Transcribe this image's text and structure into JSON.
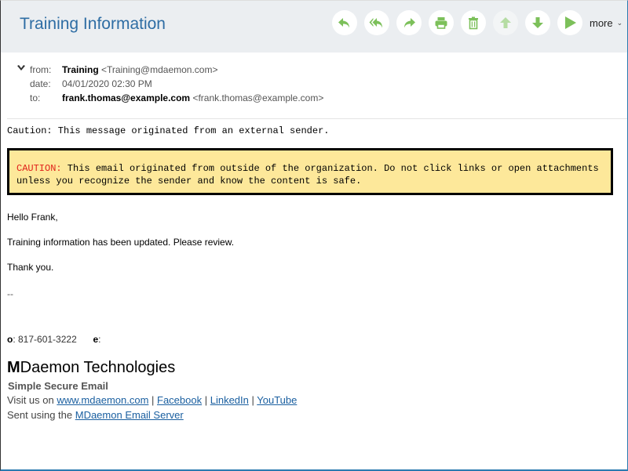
{
  "header": {
    "title": "Training Information",
    "toolbar": [
      {
        "name": "reply-button",
        "icon": "reply-icon",
        "disabled": false
      },
      {
        "name": "reply-all-button",
        "icon": "reply-all-icon",
        "disabled": false
      },
      {
        "name": "forward-button",
        "icon": "forward-icon",
        "disabled": false
      },
      {
        "name": "print-button",
        "icon": "print-icon",
        "disabled": false
      },
      {
        "name": "delete-button",
        "icon": "trash-icon",
        "disabled": false
      },
      {
        "name": "previous-button",
        "icon": "arrow-up-icon",
        "disabled": true
      },
      {
        "name": "next-button",
        "icon": "arrow-down-icon",
        "disabled": false
      },
      {
        "name": "play-button",
        "icon": "play-icon",
        "disabled": false
      }
    ],
    "more_label": "more",
    "more_chevron": "⌄",
    "accent_color": "#7cc05a"
  },
  "meta": {
    "toggle_glyph": "❯",
    "from_label": "from:",
    "from_name": "Training",
    "from_address": "<Training@mdaemon.com>",
    "date_label": "date:",
    "date_value": "04/01/2020 02:30 PM",
    "to_label": "to:",
    "to_name": "frank.thomas@example.com",
    "to_address": "<frank.thomas@example.com>"
  },
  "body": {
    "external_notice": "Caution: This message originated from an external sender.",
    "caution_label": "CAUTION:",
    "caution_text": " This email originated from outside of the organization. Do not click links or open attachments unless you recognize the sender and know the content is safe.",
    "greeting": "Hello Frank,",
    "message": "Training information has been updated. Please review.",
    "closing": "Thank you.",
    "separator": "--",
    "phone_label": "o",
    "phone_value": ": 817-601-3222",
    "email_label": "e",
    "email_value": ":",
    "brand_initial": "M",
    "brand_rest": "Daemon Technologies",
    "tagline": "Simple Secure Email",
    "visit_prefix": "Visit us on ",
    "links": [
      "www.mdaemon.com",
      "Facebook",
      "LinkedIn",
      "YouTube"
    ],
    "link_separator": " | ",
    "sent_prefix": "Sent using the ",
    "sent_link": "MDaemon Email Server"
  }
}
